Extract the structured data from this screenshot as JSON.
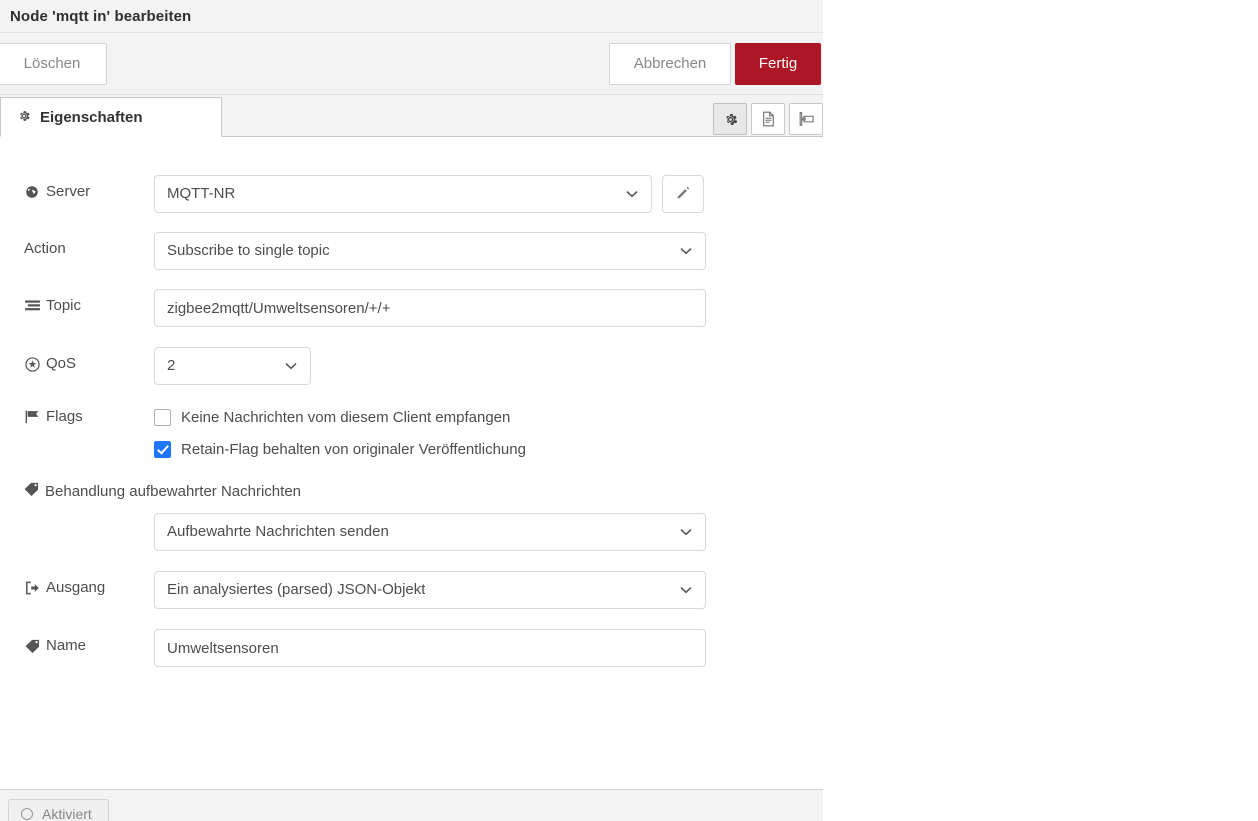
{
  "dialog": {
    "title": "Node 'mqtt in' bearbeiten"
  },
  "actions": {
    "delete_label": "Löschen",
    "cancel_label": "Abbrechen",
    "done_label": "Fertig",
    "primary_color": "#ad1625"
  },
  "tabs": {
    "properties": {
      "label": "Eigenschaften",
      "icon": "gear-icon"
    },
    "tools": [
      {
        "name": "gear-icon",
        "active": true
      },
      {
        "name": "description-icon",
        "active": false
      },
      {
        "name": "appearance-icon",
        "active": false
      }
    ]
  },
  "form": {
    "server": {
      "label": "Server",
      "icon": "globe-icon",
      "value": "MQTT-NR",
      "edit_button": "pencil-icon"
    },
    "action": {
      "label": "Action",
      "value": "Subscribe to single topic"
    },
    "topic": {
      "label": "Topic",
      "icon": "tasks-icon",
      "value": "zigbee2mqtt/Umweltsensoren/+/+",
      "placeholder": "Topic"
    },
    "qos": {
      "label": "QoS",
      "icon": "asterisk-icon",
      "value": "2"
    },
    "flags": {
      "label": "Flags",
      "icon": "flag-icon",
      "items": [
        {
          "label": "Keine Nachrichten vom diesem Client empfangen",
          "checked": false
        },
        {
          "label": "Retain-Flag behalten von originaler Veröffentlichung",
          "checked": true
        }
      ],
      "checked_color": "#2176ff"
    },
    "retained_handling": {
      "label": "Behandlung aufbewahrter Nachrichten",
      "icon": "tag-icon",
      "value": "Aufbewahrte Nachrichten senden"
    },
    "output": {
      "label": "Ausgang",
      "icon": "sign-out-icon",
      "value": "Ein analysiertes (parsed) JSON-Objekt"
    },
    "name": {
      "label": "Name",
      "icon": "tag-icon",
      "value": "Umweltsensoren",
      "placeholder": "Name"
    }
  },
  "footer": {
    "enabled_toggle": {
      "label": "Aktiviert",
      "icon": "circle-icon"
    }
  }
}
